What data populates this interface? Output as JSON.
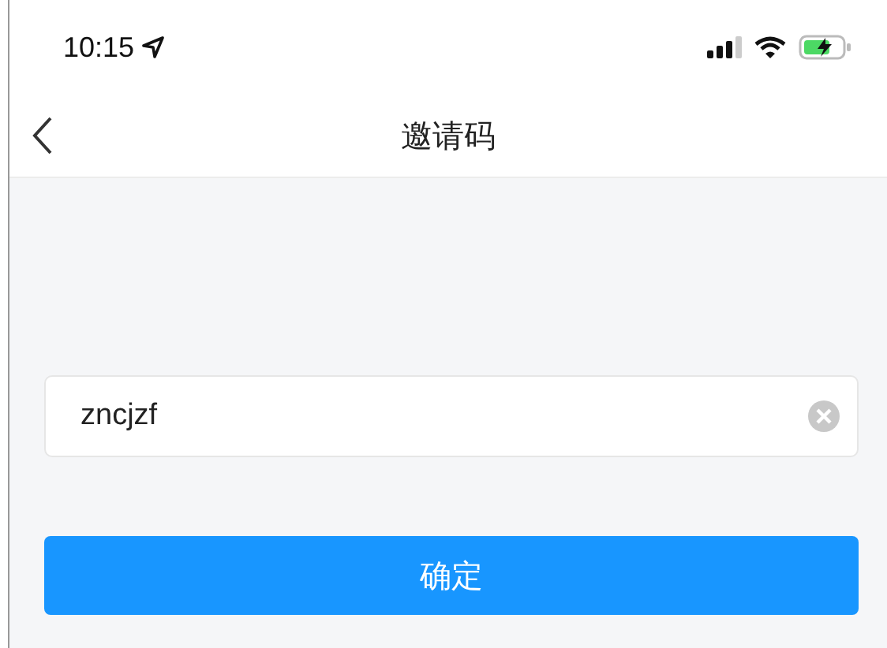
{
  "status_bar": {
    "time": "10:15"
  },
  "nav_bar": {
    "title": "邀请码"
  },
  "invite_field": {
    "value": "zncjzf"
  },
  "buttons": [
    {
      "label": "确定"
    }
  ]
}
